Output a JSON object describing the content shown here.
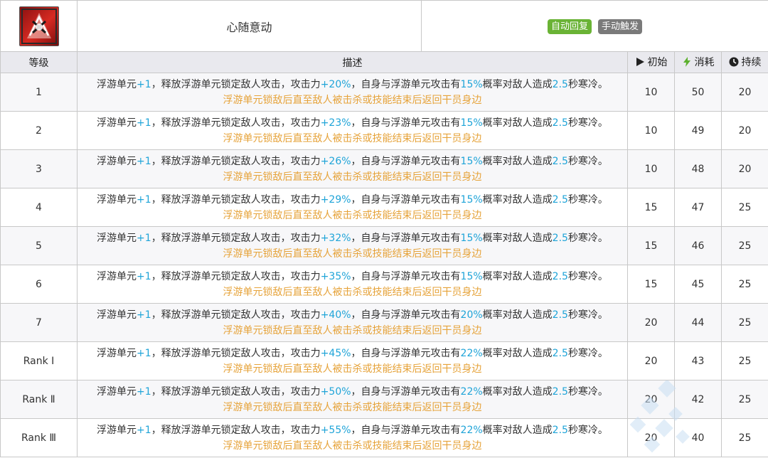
{
  "skill": {
    "icon": "skill-emblem-icon",
    "name": "心随意动",
    "tags": {
      "auto": "自动回复",
      "manual": "手动触发"
    }
  },
  "headers": {
    "level": "等级",
    "description": "描述",
    "initial": "初始",
    "cost": "消耗",
    "duration": "持续"
  },
  "colors": {
    "highlight": "#1fa4d8",
    "note": "#e6a33a",
    "auto_tag": "#6ab335",
    "manual_tag": "#7a7a7a"
  },
  "desc_parts": {
    "p1": "浮游单元",
    "p2": "，释放浮游单元锁定敌人攻击，攻击力",
    "p3": "，自身与浮游单元攻击有",
    "p4": "概率对敌人造成",
    "p5": "秒寒冷。",
    "note": "浮游单元锁敌后直至敌人被击杀或技能结束后返回干员身边"
  },
  "rows": [
    {
      "level": "1",
      "units": "+1",
      "atk": "+20%",
      "chance": "15%",
      "chill": "2.5",
      "initial": "10",
      "cost": "50",
      "duration": "20"
    },
    {
      "level": "2",
      "units": "+1",
      "atk": "+23%",
      "chance": "15%",
      "chill": "2.5",
      "initial": "10",
      "cost": "49",
      "duration": "20"
    },
    {
      "level": "3",
      "units": "+1",
      "atk": "+26%",
      "chance": "15%",
      "chill": "2.5",
      "initial": "10",
      "cost": "48",
      "duration": "20"
    },
    {
      "level": "4",
      "units": "+1",
      "atk": "+29%",
      "chance": "15%",
      "chill": "2.5",
      "initial": "15",
      "cost": "47",
      "duration": "25"
    },
    {
      "level": "5",
      "units": "+1",
      "atk": "+32%",
      "chance": "15%",
      "chill": "2.5",
      "initial": "15",
      "cost": "46",
      "duration": "25"
    },
    {
      "level": "6",
      "units": "+1",
      "atk": "+35%",
      "chance": "15%",
      "chill": "2.5",
      "initial": "15",
      "cost": "45",
      "duration": "25"
    },
    {
      "level": "7",
      "units": "+1",
      "atk": "+40%",
      "chance": "20%",
      "chill": "2.5",
      "initial": "20",
      "cost": "44",
      "duration": "25"
    },
    {
      "level": "Rank Ⅰ",
      "units": "+1",
      "atk": "+45%",
      "chance": "22%",
      "chill": "2.5",
      "initial": "20",
      "cost": "43",
      "duration": "25"
    },
    {
      "level": "Rank Ⅱ",
      "units": "+1",
      "atk": "+50%",
      "chance": "22%",
      "chill": "2.5",
      "initial": "20",
      "cost": "42",
      "duration": "25"
    },
    {
      "level": "Rank Ⅲ",
      "units": "+1",
      "atk": "+55%",
      "chance": "22%",
      "chill": "2.5",
      "initial": "20",
      "cost": "40",
      "duration": "25"
    }
  ]
}
